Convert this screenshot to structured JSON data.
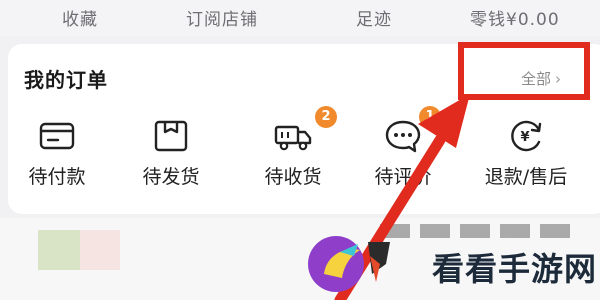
{
  "top_bar": {
    "items": [
      "收藏",
      "订阅店铺",
      "足迹",
      "零钱¥0.00"
    ]
  },
  "orders": {
    "title": "我的订单",
    "view_all": "全部",
    "items": [
      {
        "label": "待付款",
        "icon": "wallet-icon",
        "badge": null
      },
      {
        "label": "待发货",
        "icon": "package-icon",
        "badge": null
      },
      {
        "label": "待收货",
        "icon": "truck-icon",
        "badge": "2"
      },
      {
        "label": "待评价",
        "icon": "chat-bubble-icon",
        "badge": "1"
      },
      {
        "label": "退款/售后",
        "icon": "refund-icon",
        "badge": null
      }
    ]
  },
  "watermark": {
    "text": "看看手游网"
  },
  "colors": {
    "highlight": "#e22b1f",
    "badge": "#f08a2c"
  }
}
